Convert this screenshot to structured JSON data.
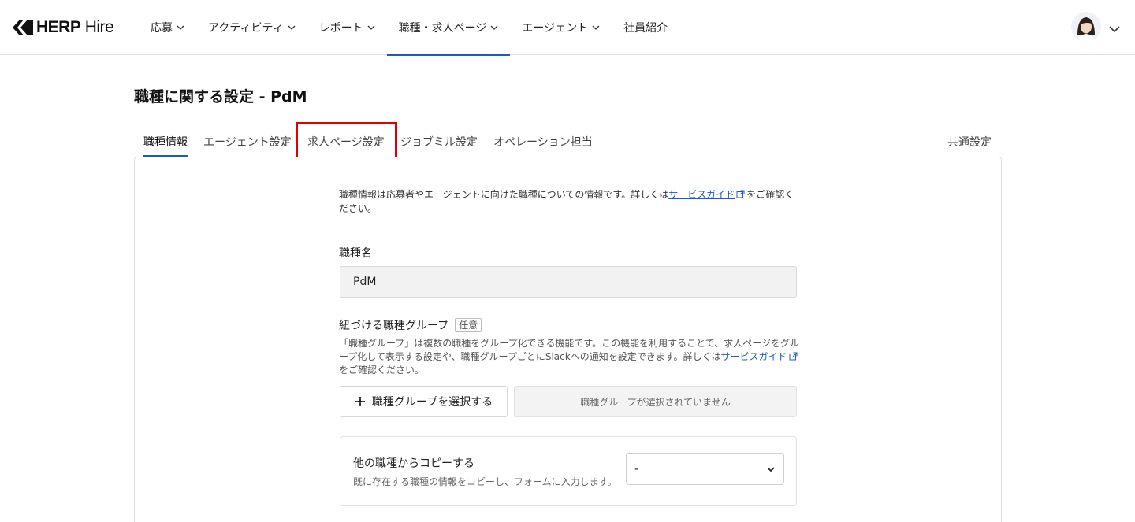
{
  "header": {
    "brand_bold": "HERP",
    "brand_light": " Hire",
    "nav": [
      {
        "label": "応募",
        "has_dropdown": true
      },
      {
        "label": "アクティビティ",
        "has_dropdown": true
      },
      {
        "label": "レポート",
        "has_dropdown": true
      },
      {
        "label": "職種・求人ページ",
        "has_dropdown": true,
        "active": true
      },
      {
        "label": "エージェント",
        "has_dropdown": true
      },
      {
        "label": "社員紹介",
        "has_dropdown": false
      }
    ]
  },
  "page": {
    "title": "職種に関する設定 - PdM"
  },
  "tabs": [
    {
      "label": "職種情報",
      "active": true
    },
    {
      "label": "エージェント設定"
    },
    {
      "label": "求人ページ設定",
      "highlighted": true
    },
    {
      "label": "ジョブミル設定"
    },
    {
      "label": "オペレーション担当"
    },
    {
      "label": "共通設定"
    }
  ],
  "form": {
    "intro_before": "職種情報は応募者やエージェントに向けた職種についての情報です。詳しくは",
    "intro_link": "サービスガイド",
    "intro_after": "をご確認ください。",
    "job_name_label": "職種名",
    "job_name_value": "PdM",
    "group_label": "紐づける職種グループ",
    "group_optional_badge": "任意",
    "group_help_before": "「職種グループ」は複数の職種をグループ化できる機能です。この機能を利用することで、求人ページをグループ化して表示する設定や、職種グループごとにSlackへの通知を設定できます。詳しくは",
    "group_help_link": "サービスガイド",
    "group_help_after": "をご確認ください。",
    "select_group_button": "職種グループを選択する",
    "no_group_text": "職種グループが選択されていません",
    "copy_title": "他の職種からコピーする",
    "copy_desc": "既に存在する職種の情報をコピーし、フォームに入力します。",
    "copy_select_value": "-"
  },
  "colors": {
    "accent": "#1f5bbf",
    "highlight": "#e00000"
  }
}
